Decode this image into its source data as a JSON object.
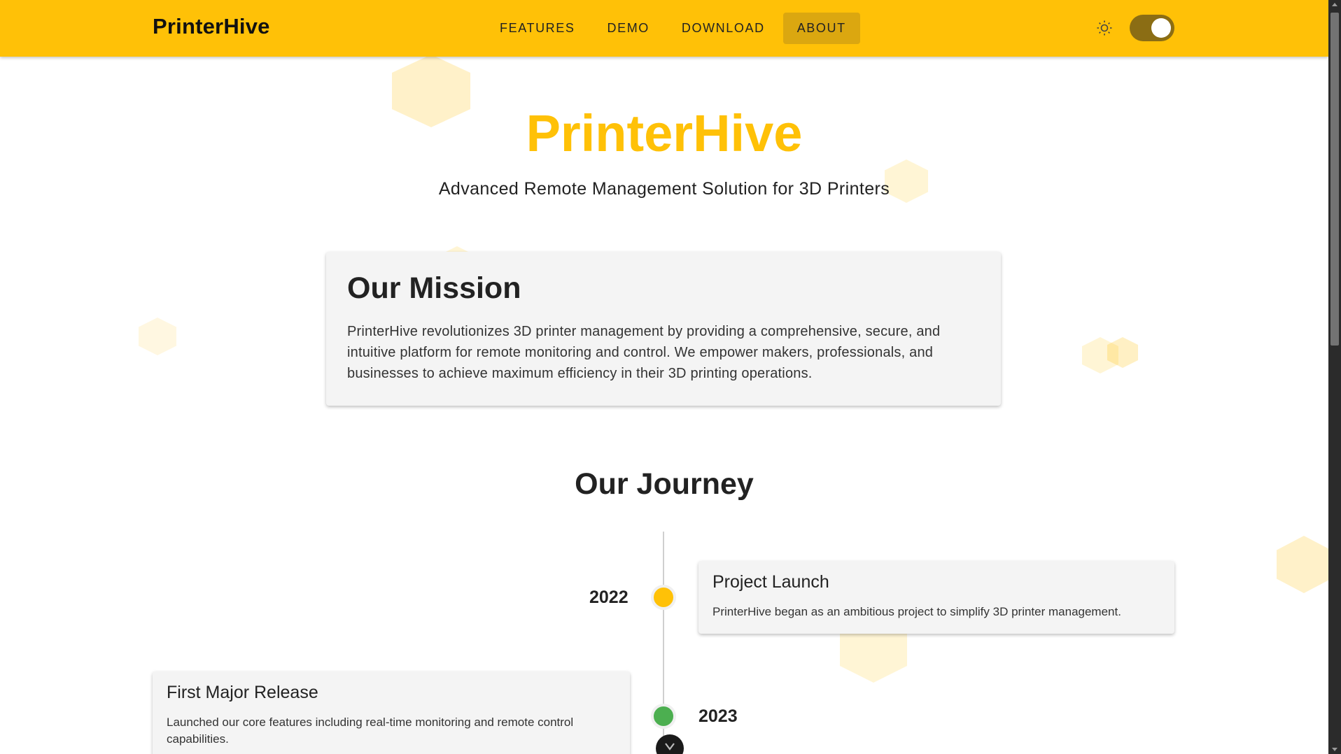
{
  "header": {
    "brand": "PrinterHive",
    "nav": [
      "FEATURES",
      "DEMO",
      "DOWNLOAD",
      "ABOUT"
    ],
    "active_nav": "ABOUT",
    "theme_icon": "sun-icon",
    "dark_mode_toggle_on": true
  },
  "hero": {
    "title": "PrinterHive",
    "subtitle": "Advanced Remote Management Solution for 3D Printers"
  },
  "mission": {
    "title": "Our Mission",
    "text": "PrinterHive revolutionizes 3D printer management by providing a comprehensive, secure, and intuitive platform for remote monitoring and control. We empower makers, professionals, and businesses to achieve maximum efficiency in their 3D printing operations."
  },
  "journey": {
    "title": "Our Journey",
    "events": [
      {
        "year": "2022",
        "title": "Project Launch",
        "text": "PrinterHive began as an ambitious project to simplify 3D printer management."
      },
      {
        "year": "2023",
        "title": "First Major Release",
        "text": "Launched our core features including real-time monitoring and remote control capabilities."
      }
    ]
  },
  "colors": {
    "accent": "#ffc107",
    "active_nav_bg": "#dba710",
    "toggle_track": "#8b6d14",
    "dot_2022": "#ffc107",
    "dot_2023": "#4caf50"
  }
}
